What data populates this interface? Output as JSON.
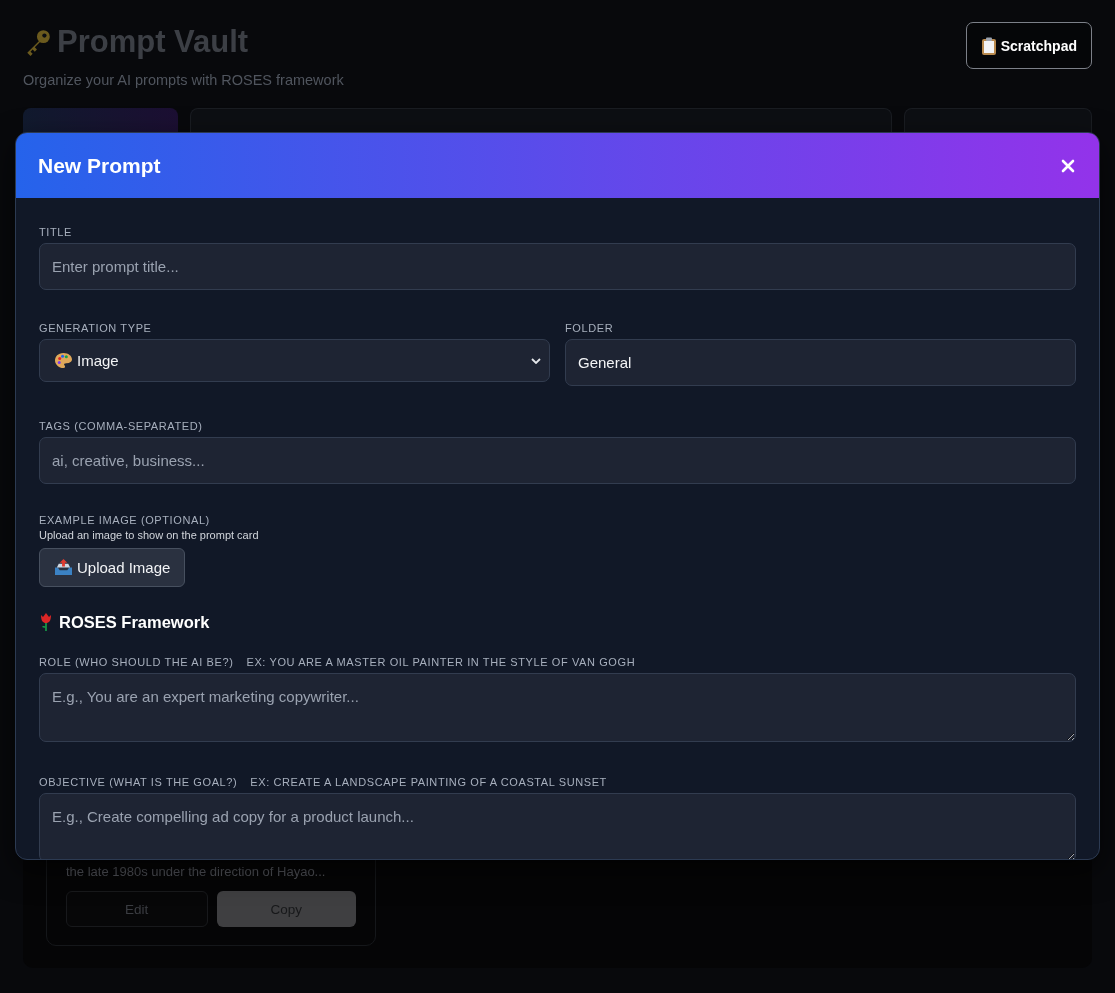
{
  "background": {
    "title": "Prompt Vault",
    "subtitle": "Organize your AI prompts with ROSES framework",
    "scratchpad_button": "Scratchpad",
    "card": {
      "description": "the late 1980s under the direction of Hayao...",
      "buttons": [
        "Edit",
        "Copy"
      ]
    }
  },
  "modal": {
    "title": "New Prompt",
    "title_field": {
      "label": "TITLE",
      "placeholder": "Enter prompt title..."
    },
    "generation_type": {
      "label": "GENERATION TYPE",
      "value": "Image"
    },
    "folder": {
      "label": "FOLDER",
      "value": "General"
    },
    "tags": {
      "label": "TAGS (COMMA-SEPARATED)",
      "placeholder": "ai, creative, business..."
    },
    "example_image": {
      "label": "EXAMPLE IMAGE (OPTIONAL)",
      "hint": "Upload an image to show on the prompt card",
      "button": "Upload Image"
    },
    "roses": {
      "heading": "ROSES Framework",
      "fields": [
        {
          "label": "ROLE (WHO SHOULD THE AI BE?)",
          "example": "EX: YOU ARE A MASTER OIL PAINTER IN THE STYLE OF VAN GOGH",
          "placeholder": "E.g., You are an expert marketing copywriter..."
        },
        {
          "label": "OBJECTIVE (WHAT IS THE GOAL?)",
          "example": "EX: CREATE A LANDSCAPE PAINTING OF A COASTAL SUNSET",
          "placeholder": "E.g., Create compelling ad copy for a product launch..."
        }
      ]
    }
  }
}
